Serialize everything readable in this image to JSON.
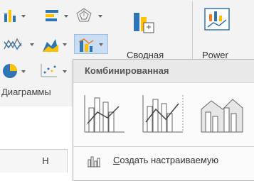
{
  "ribbon": {
    "group_label": "Диаграммы",
    "pivot_chart_label": "Сводная",
    "power_label": "Power"
  },
  "sheet": {
    "column_h": "H"
  },
  "combo_menu": {
    "title": "Комбинированная",
    "create_custom_prefix": "С",
    "create_custom_rest": "оздать настраиваемую"
  },
  "icons": {
    "bar": "bar-chart-icon",
    "hierarchy": "hierarchy-chart-icon",
    "radar": "radar-chart-icon",
    "line": "line-chart-icon",
    "area": "area-chart-icon",
    "combo": "combo-chart-icon",
    "pie": "pie-chart-icon",
    "scatter": "scatter-chart-icon",
    "pivot": "pivot-chart-icon",
    "power": "power-view-icon",
    "custom_combo": "custom-combo-chart-icon"
  },
  "colors": {
    "accent_blue": "#2e75b6",
    "accent_orange": "#ed7d31",
    "accent_gold": "#ffc000",
    "selected_bg": "#c9def3"
  }
}
